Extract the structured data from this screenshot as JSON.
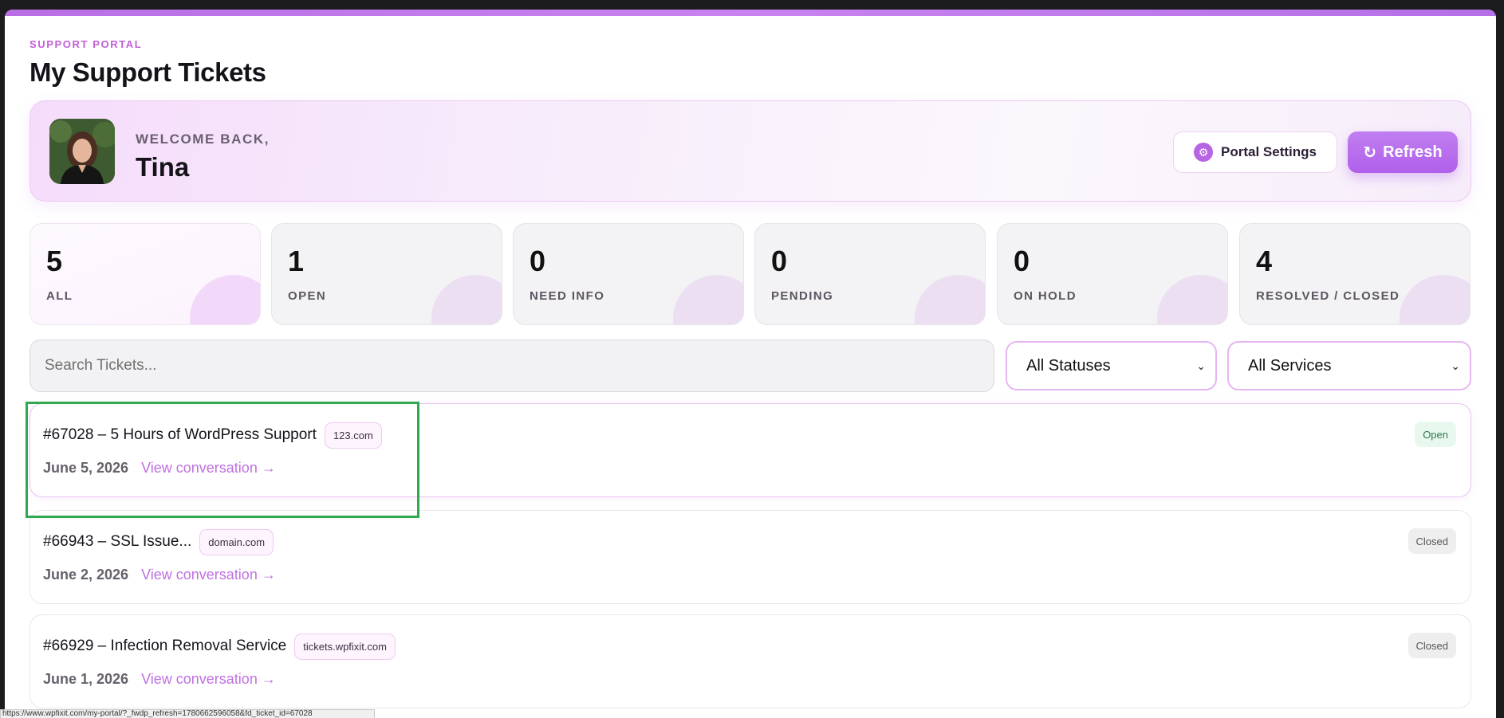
{
  "portal": {
    "eyebrow": "SUPPORT PORTAL",
    "title": "My Support Tickets"
  },
  "welcome": {
    "label": "WELCOME BACK,",
    "name": "Tina"
  },
  "actions": {
    "settings_label": "Portal Settings",
    "settings_icon": "gear-icon",
    "refresh_label": "Refresh",
    "refresh_icon": "refresh-icon"
  },
  "stats": [
    {
      "count": "5",
      "label": "ALL"
    },
    {
      "count": "1",
      "label": "OPEN"
    },
    {
      "count": "0",
      "label": "NEED INFO"
    },
    {
      "count": "0",
      "label": "PENDING"
    },
    {
      "count": "0",
      "label": "ON HOLD"
    },
    {
      "count": "4",
      "label": "RESOLVED / CLOSED"
    }
  ],
  "filters": {
    "search_placeholder": "Search Tickets...",
    "status_selected": "All Statuses",
    "service_selected": "All Services"
  },
  "tickets": [
    {
      "title": "#67028 – 5 Hours of WordPress Support",
      "tag": "123.com",
      "date": "June 5, 2026",
      "link": "View conversation →",
      "status": "Open"
    },
    {
      "title": "#66943 – SSL Issue...",
      "tag": "domain.com",
      "date": "June 2, 2026",
      "link": "View conversation →",
      "status": "Closed"
    },
    {
      "title": "#66929 – Infection Removal Service",
      "tag": "tickets.wpfixit.com",
      "date": "June 1, 2026",
      "link": "View conversation →",
      "status": "Closed"
    }
  ],
  "statusbar_url": "https://www.wpfixit.com/my-portal/?_fwdp_refresh=1780662596058&fd_ticket_id=67028",
  "colors": {
    "accent": "#c070e0",
    "highlight_box": "#2fa84f"
  }
}
